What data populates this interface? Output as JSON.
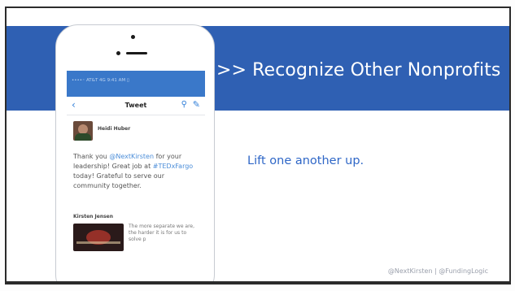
{
  "slide": {
    "title": ">> Recognize Other Nonprofits",
    "subtitle": "Lift one another up.",
    "footer": "@NextKirsten | @FundingLogic"
  },
  "phone": {
    "status_text": "••••◦ AT&T  4G     9:41 AM        ▯",
    "nav": {
      "back_icon": "chevron-left-icon",
      "title": "Tweet",
      "search_icon": "search-icon",
      "compose_icon": "compose-icon"
    },
    "tweet": {
      "author": "Heidi Huber",
      "text_1": "Thank you ",
      "mention_1": "@NextKirsten",
      "text_2": " for your leadership! Great job at ",
      "mention_2": "#TEDxFargo",
      "text_3": " today! Grateful to serve our community together."
    },
    "card": {
      "label": "Kirsten Jensen",
      "text": "The more separate we are, the harder it is for us to solve p"
    }
  },
  "colors": {
    "banner": "#2f60b3",
    "subtitle": "#2f67c7",
    "link": "#4c8ed9"
  }
}
